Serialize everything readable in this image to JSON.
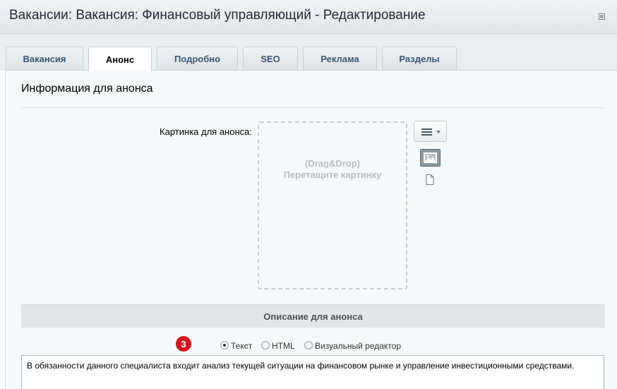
{
  "header": {
    "title": "Вакансии: Вакансия: Финансовый управляющий - Редактирование"
  },
  "tabs": [
    {
      "label": "Вакансия",
      "active": false
    },
    {
      "label": "Анонс",
      "active": true
    },
    {
      "label": "Подробно",
      "active": false
    },
    {
      "label": "SEO",
      "active": false
    },
    {
      "label": "Реклама",
      "active": false
    },
    {
      "label": "Разделы",
      "active": false
    }
  ],
  "section": {
    "title": "Информация для анонса"
  },
  "preview_picture": {
    "label": "Картинка для анонса:",
    "dropzone_line1": "(Drag&Drop)",
    "dropzone_line2": "Перетащите картинку"
  },
  "description": {
    "header": "Описание для анонса",
    "badge": "3",
    "modes": [
      {
        "label": "Текст",
        "checked": true
      },
      {
        "label": "HTML",
        "checked": false
      },
      {
        "label": "Визуальный редактор",
        "checked": false
      }
    ],
    "text": "В обязанности данного специалиста входит анализ текущей ситуации на финансовом рынке и управление инвестиционными средствами."
  },
  "colors": {
    "badge": "#d3151d",
    "tab_text": "#3b5774",
    "panel_bg": "#f5f9f9"
  }
}
